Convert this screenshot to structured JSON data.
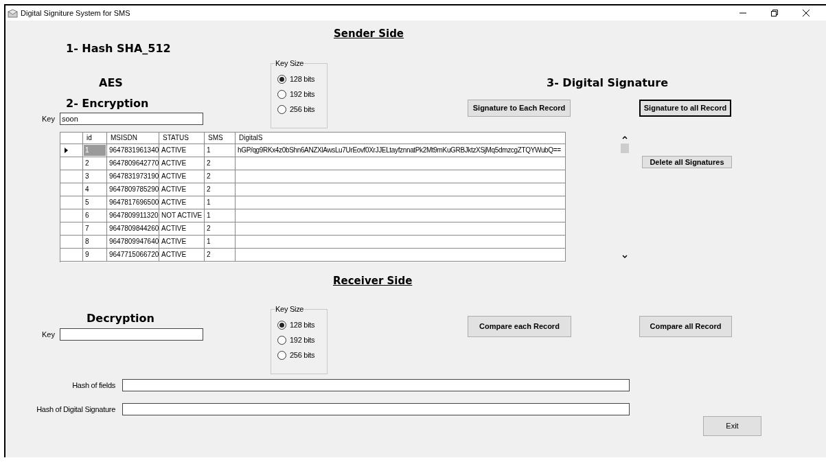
{
  "window": {
    "title": "Digital Signiture System for SMS"
  },
  "sender": {
    "heading": "Sender Side",
    "hash_label": "1- Hash SHA_512",
    "aes_label": "AES",
    "encryption_label": "2- Encryption",
    "signature_label": "3- Digital Signature",
    "key": {
      "label": "Key",
      "value": "soon"
    },
    "key_size": {
      "legend": "Key Size",
      "options": [
        {
          "label": "128 bits",
          "selected": true
        },
        {
          "label": "192 bits",
          "selected": false
        },
        {
          "label": "256 bits",
          "selected": false
        }
      ]
    },
    "buttons": [
      {
        "label": "Signature to Each Record",
        "default": false
      },
      {
        "label": "Signature to all Record",
        "default": true
      }
    ],
    "delete_button": "Delete all Signatures"
  },
  "table": {
    "columns": [
      "id",
      "MSISDN",
      "STATUS",
      "SMS",
      "DigitalS"
    ],
    "rows": [
      {
        "selected": true,
        "cells": [
          "1",
          "9647831961340",
          "ACTIVE",
          "1",
          "hGP/qg9RKx4z0bShn6ANZXlAwsLu7UrEovf0XrJJELtayfznnatPk2Mt9mKuGRBJktzXSjMq5dmzcgZTQYWubQ=="
        ]
      },
      {
        "selected": false,
        "cells": [
          "2",
          "9647809642770",
          "ACTIVE",
          "2"
        ]
      },
      {
        "selected": false,
        "cells": [
          "3",
          "9647831973190",
          "ACTIVE",
          "2"
        ]
      },
      {
        "selected": false,
        "cells": [
          "4",
          "9647809785290",
          "ACTIVE",
          "2"
        ]
      },
      {
        "selected": false,
        "cells": [
          "5",
          "9647817696500",
          "ACTIVE",
          "1"
        ]
      },
      {
        "selected": false,
        "cells": [
          "6",
          "9647809911320",
          "NOT ACTIVE",
          "1"
        ]
      },
      {
        "selected": false,
        "cells": [
          "7",
          "9647809844260",
          "ACTIVE",
          "2"
        ]
      },
      {
        "selected": false,
        "cells": [
          "8",
          "9647809947640",
          "ACTIVE",
          "1"
        ]
      },
      {
        "selected": false,
        "cells": [
          "9",
          "9647715066720",
          "ACTIVE",
          "2"
        ]
      }
    ]
  },
  "receiver": {
    "heading": "Receiver Side",
    "decryption_label": "Decryption",
    "key": {
      "label": "Key"
    },
    "key_size": {
      "legend": "Key Size",
      "options": [
        {
          "label": "128 bits",
          "selected": true
        },
        {
          "label": "192 bits",
          "selected": false
        },
        {
          "label": "256 bits",
          "selected": false
        }
      ]
    },
    "buttons": [
      {
        "label": "Compare each Record",
        "default": false
      },
      {
        "label": "Compare all Record",
        "default": false
      }
    ],
    "hash_fields": [
      {
        "label": "Hash of fields"
      },
      {
        "label": "Hash of Digital Signature"
      }
    ],
    "exit_button": "Exit"
  }
}
